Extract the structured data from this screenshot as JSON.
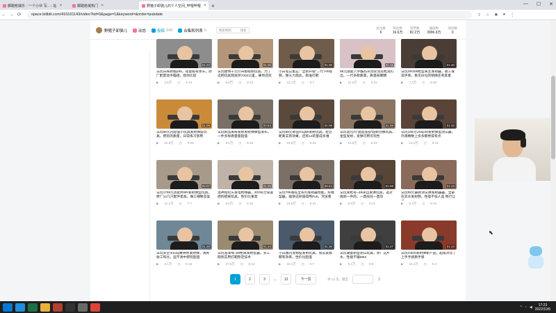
{
  "browser": {
    "tabs": [
      {
        "label": "脚踏枪械乐 - '一个小伙 写... - 站",
        "active": false,
        "color": "#fb7299"
      },
      {
        "label": "脚踏枪械热门",
        "active": false,
        "color": "#fb7299"
      },
      {
        "label": "野猪子卸骆儿的个人空间_哔哩哔哩",
        "active": true,
        "color": "#fb7299"
      }
    ],
    "new_tab": "+",
    "url": "space.bilibili.com/416161143/video?tid=0&page=1&keyword=&order=pubdate",
    "win_controls": [
      "—",
      "☐",
      "✕"
    ]
  },
  "nav": {
    "username": "野猪子卸骆儿",
    "dynamic": "动态",
    "submissions": "投稿",
    "submissions_count": "343",
    "collections": "合集和列表",
    "collections_count": "0",
    "search_placeholder": "搜索视频",
    "search_button": "搜索",
    "stats": [
      {
        "label": "关注数",
        "value": "6"
      },
      {
        "label": "粉丝数",
        "value": "16.6万"
      },
      {
        "label": "获赞数",
        "value": "82.2万"
      },
      {
        "label": "播放数",
        "value": "3996.6万"
      },
      {
        "label": "阅读数",
        "value": "0"
      }
    ]
  },
  "videos": [
    {
      "title": "试玩乐辉新版p55，轻量级有亲头，原厂配套动手瞄组，给你比较",
      "views": "3.6万",
      "date": "9-14",
      "duration": "01:23",
      "bg": "#8d8d8d"
    },
    {
      "title": "试玩捷博千元Cow拍视频玩具，为了这把玩具我竟然7000公里，果然还玩",
      "views": "5.5万",
      "date": "9-12",
      "duration": "01:25",
      "bg": "#b39679"
    },
    {
      "title": "小白笔记第五：全新升级“二代”AR视频，弹火力炮兵，稳准打靶",
      "views": "12.1万",
      "date": "9-7",
      "duration": "01:30",
      "bg": "#6f5c4b"
    },
    {
      "title": "98元就能入手酷Zy的左轮左轮枪竟打出，一代多款质量，质量很硬朗",
      "views": "21.6万",
      "date": "8-31",
      "duration": "01:15",
      "bg": "#d8c2c6"
    },
    {
      "title": "试玩SR308枪型离主发射器，收工很常评率，看见份位的稍微还有其者",
      "views": "7.2万",
      "date": "8-30",
      "duration": "01:20",
      "bg": "#4a3d35"
    },
    {
      "title": "试玩66元内超值小玩具发射弹型玩具，把玩的质量，日常练习够用",
      "views": "22.5万",
      "date": "8-29",
      "duration": "01:09",
      "bg": "#c98b3a"
    },
    {
      "title": "试玩新品离奇发射发射弹弹型发布，一件多样质量量超值",
      "views": "8.5万",
      "date": "8-26",
      "duration": "00:53",
      "bg": "#7a7066"
    },
    {
      "title": "试玩88元新品Kng98发射玩具，拉近距离实有效果，还有12的量成多维",
      "views": "23.6万",
      "date": "8-25",
      "duration": "01:08",
      "bg": "#5b4a3c"
    },
    {
      "title": "试玩混元内“混战混战”超新创弹玩具，金型发射，发弹可用可玩性",
      "views": "15.8万",
      "date": "8-23",
      "duration": "01:08",
      "bg": "#8c7462"
    },
    {
      "title": "试玩168元vinkp40发射弹型测试器，外观精致上多多都觉得有点",
      "views": "13.2万",
      "date": "8-12",
      "duration": "01:33",
      "bg": "#5a4438"
    },
    {
      "title": "试玩1796元高配Rt5R发射弹型玩具，原厂10几只配件套具，做工细致反复",
      "views": "11.1万",
      "date": "7-7",
      "duration": "02:07",
      "bg": "#a79a8a"
    },
    {
      "title": "混神指玩头发电枪弹器，200块兰快速结构搭接玩具，性价比重高",
      "views": "6.6万",
      "date": "6-16",
      "duration": "01:26",
      "bg": "#bfb3a8"
    },
    {
      "title": "试玩799毒蛇全系列发射器性能，好模型器，能够这样值得用Po8，浏览看",
      "views": "16.6万",
      "date": "6-24",
      "duration": "00:24",
      "bg": "#7c6f66"
    },
    {
      "title": "试玩发枪有=48a8自发弹玩具，选对挑剃一件的，一直找兆一直毕",
      "views": "8.6万",
      "date": "6-21",
      "duration": "01:58",
      "bg": "#574538"
    },
    {
      "title": "试玩98元最新测试弹发射器器，全部在双水发射频，性能不低人品 牧行让说",
      "views": "6.4万",
      "date": "6-16",
      "duration": "01:23",
      "bg": "#8a6a5a"
    },
    {
      "title": "试玩买空头lung黄映吹发射弹，清爽收工和比，运不清中把玩超值",
      "views": "3.1万",
      "date": "6-16",
      "duration": "01:28",
      "bg": "#6f8796"
    },
    {
      "title": "试玩浩泽啤=68枪离发射套器，多工刚到实用打靶稳定技术",
      "views": "27.6万",
      "date": "6-12",
      "duration": "01:34",
      "bg": "#9a8a70"
    },
    {
      "title": "小白鑫内宠物型发射玩具，省去良都都有效率，性价比超值",
      "views": "15.4万",
      "date": "6-7",
      "duration": "01:36",
      "bg": "#4a5a6a"
    },
    {
      "title": "试玩潮量新型测试玩具，原厂这片水，性能不输M63",
      "views": "8.1万",
      "date": "6-6",
      "duration": "01:47",
      "bg": "#3f3f3f"
    },
    {
      "title": "试玩m500发射弹新产品，超级对比了上手手感质手感",
      "views": "24.1万",
      "date": "5-4",
      "duration": "01:43",
      "bg": "#8a3a2a"
    }
  ],
  "pager": {
    "pages": [
      "1",
      "2",
      "3",
      "...",
      "12"
    ],
    "next": "下一页",
    "total_text": "共 12 页，跳至",
    "page_suffix": "页"
  },
  "taskbar": {
    "time": "17:23",
    "date": "2022/10/6",
    "apps": [
      {
        "name": "start",
        "color": "#0078d7"
      },
      {
        "name": "edge",
        "color": "#1d8fdb"
      },
      {
        "name": "excel",
        "color": "#1e7145"
      },
      {
        "name": "folder",
        "color": "#e8b23a"
      },
      {
        "name": "media",
        "color": "#b0402f"
      },
      {
        "name": "obs",
        "color": "#333333"
      },
      {
        "name": "app2",
        "color": "#6a6a6a"
      },
      {
        "name": "chrome",
        "color": "#dc4437"
      }
    ]
  }
}
